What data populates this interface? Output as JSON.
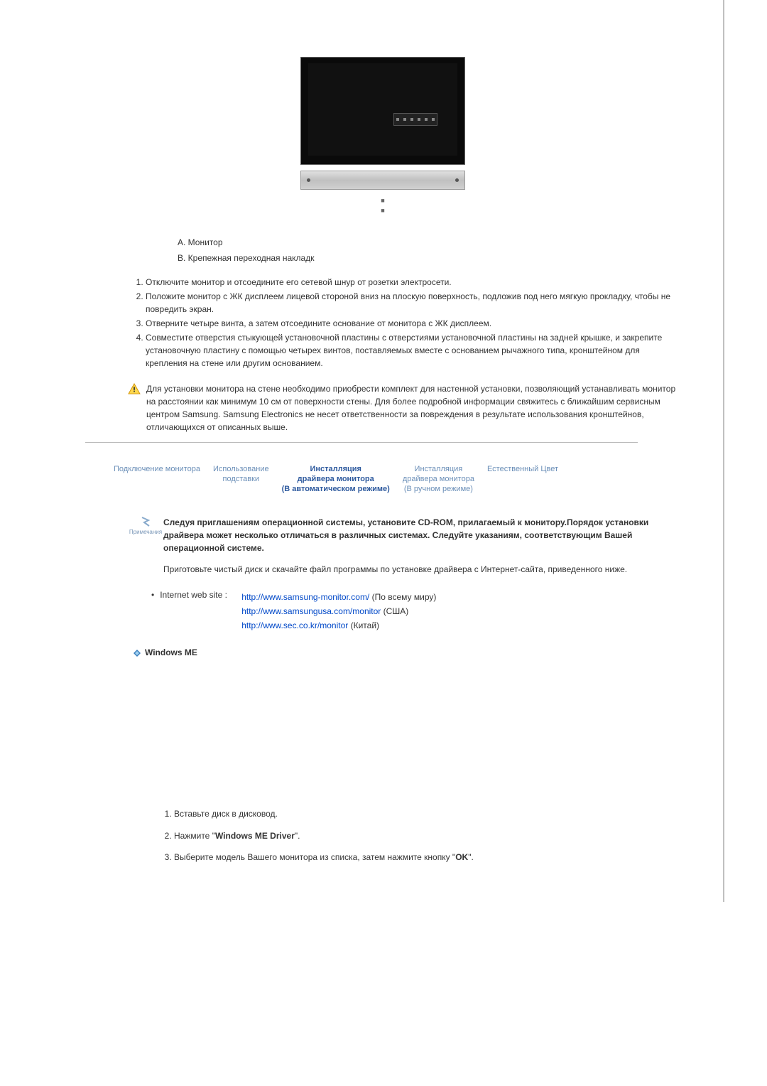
{
  "labels": {
    "a": "A. Монитор",
    "b": "B. Крепежная переходная накладк"
  },
  "mainList": [
    "Отключите монитор и отсоедините его сетевой шнур от розетки электросети.",
    "Положите монитор с ЖК дисплеем лицевой стороной вниз на плоскую поверхность, подложив под него мягкую прокладку, чтобы не повредить экран.",
    "Отверните четыре винта, а затем отсоедините основание от монитора с ЖК дисплеем.",
    "Совместите отверстия стыкующей установочной пластины с отверстиями установочной пластины на задней крышке, и закрепите установочную пластину с помощью четырех винтов, поставляемых вместе с основанием рычажного типа, кронштейном для крепления на стене или другим основанием."
  ],
  "warning": "Для установки монитора на стене необходимо приобрести комплект для настенной установки, позволяющий устанавливать монитор на расстоянии как минимум 10 см от поверхности стены. Для более подробной информации свяжитесь с ближайшим сервисным центром Samsung. Samsung Electronics не несет ответственности за повреждения в результате использования кронштейнов, отличающихся от описанных выше.",
  "navTabs": [
    {
      "line1": "Подключение монитора"
    },
    {
      "line1": "Использование",
      "line2": "подставки"
    },
    {
      "line1": "Инсталляция",
      "line2": "драйвера монитора",
      "line3": "(В автоматическом режиме)",
      "active": true
    },
    {
      "line1": "Инсталляция",
      "line2": "драйвера монитора",
      "line3": "(В ручном режиме)"
    },
    {
      "line1": "Естественный Цвет"
    }
  ],
  "noteLabel": "Примечания",
  "noteBold": "Следуя приглашениям операционной системы, установите CD-ROM, прилагаемый к монитору.Порядок установки драйвера может несколько отличаться в различных системах. Следуйте указаниям, соответствующим Вашей операционной системе.",
  "notePlain": "Приготовьте чистый диск и скачайте файл программы по установке драйвера с Интернет-сайта, приведенного ниже.",
  "linkLabel": "Internet web site :",
  "links": [
    {
      "url": "http://www.samsung-monitor.com/",
      "suffix": "(По всему миру)"
    },
    {
      "url": "http://www.samsungusa.com/monitor",
      "suffix": "(США)"
    },
    {
      "url": "http://www.sec.co.kr/monitor",
      "suffix": "(Китай)"
    }
  ],
  "sectionHeading": "Windows ME",
  "subList": [
    {
      "prefix": "Вставьте диск в дисковод."
    },
    {
      "prefix": "Нажмите \"",
      "bold": "Windows ME Driver",
      "suffix": "\"."
    },
    {
      "prefix": "Выберите модель Вашего монитора из списка, затем нажмите кнопку \"",
      "bold": "OK",
      "suffix": "\"."
    }
  ]
}
